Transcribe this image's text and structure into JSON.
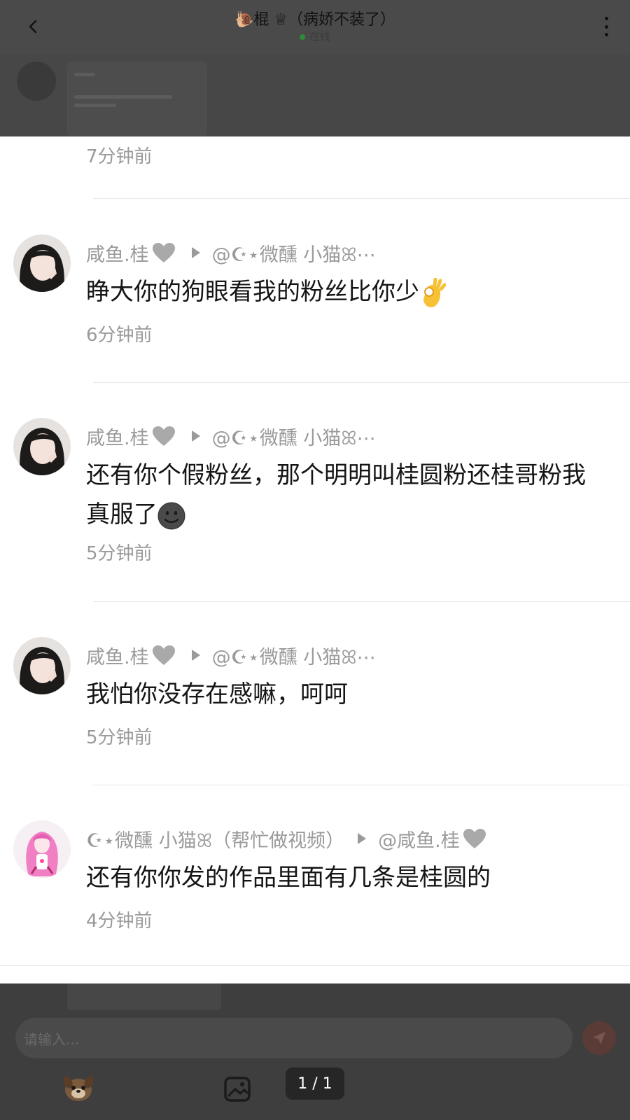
{
  "chat": {
    "title": "🐌棍 ♕（病娇不装了）",
    "status": "在线"
  },
  "comments_first_time": "7分钟前",
  "comments": [
    {
      "author": "咸鱼.桂",
      "reply_to": "@☪⋆微醺 小猫ꕤ⋯",
      "text": "睁大你的狗眼看我的粉丝比你少",
      "emoji": "ok-hand",
      "time": "6分钟前"
    },
    {
      "author": "咸鱼.桂",
      "reply_to": "@☪⋆微醺 小猫ꕤ⋯",
      "text": "还有你个假粉丝，那个明明叫桂圆粉还桂哥粉我真服了",
      "emoji": "face",
      "time": "5分钟前"
    },
    {
      "author": "咸鱼.桂",
      "reply_to": "@☪⋆微醺 小猫ꕤ⋯",
      "text": "我怕你没存在感嘛，呵呵",
      "time": "5分钟前"
    },
    {
      "author": "☪⋆微醺 小猫ꕤ（帮忙做视频）",
      "reply_to": "@咸鱼.桂",
      "text": "还有你你发的作品里面有几条是桂圆的",
      "time": "4分钟前"
    }
  ],
  "input": {
    "placeholder": "请输入..."
  },
  "pager": {
    "text": "1 / 1"
  },
  "colors": {
    "overlay": "#444444",
    "muted_text": "#9a9a9a",
    "body_text": "#151515",
    "heart": "#a9a9a9",
    "panel": "#ffffff"
  }
}
